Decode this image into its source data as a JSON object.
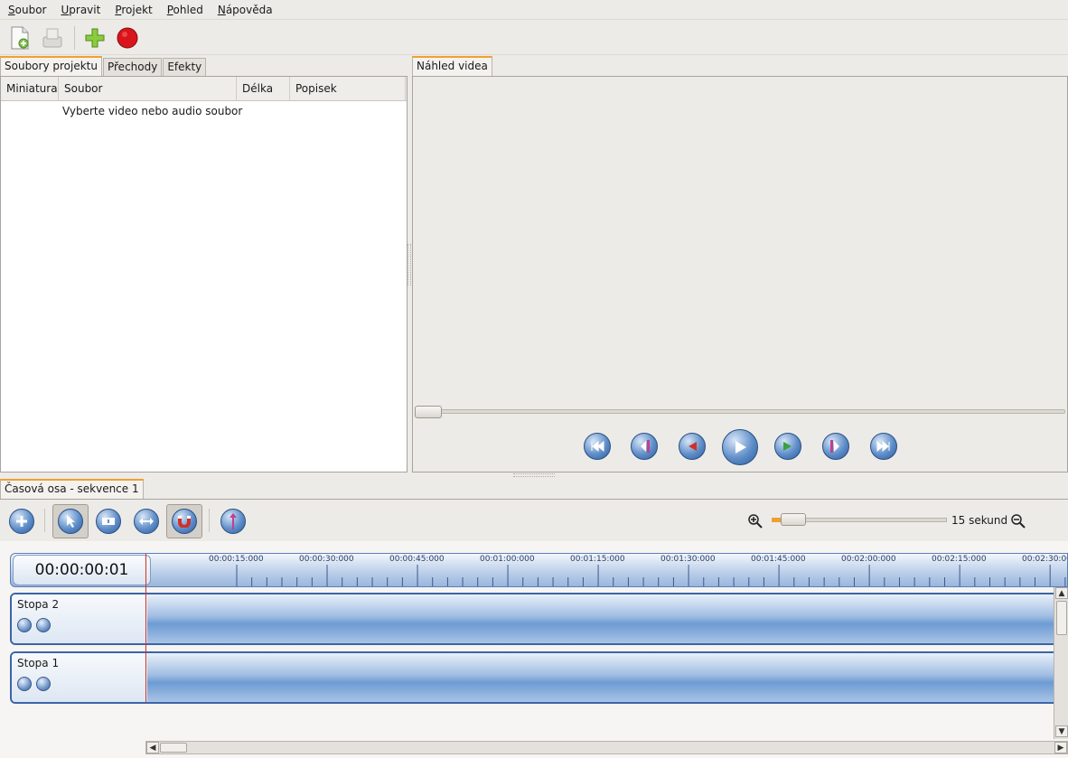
{
  "menu": [
    "Soubor",
    "Upravit",
    "Projekt",
    "Pohled",
    "Nápověda"
  ],
  "toolbar": {
    "icons": [
      "new-file-icon",
      "export-icon",
      "add-icon",
      "record-icon"
    ]
  },
  "left_panel": {
    "tabs": [
      "Soubory projektu",
      "Přechody",
      "Efekty"
    ],
    "columns": [
      "Miniatura",
      "Soubor",
      "Délka",
      "Popisek"
    ],
    "empty_message": "Vyberte video nebo audio soubor"
  },
  "preview": {
    "tab": "Náhled videa",
    "controls": [
      "skip-start-icon",
      "prev-marker-icon",
      "rewind-icon",
      "play-icon",
      "fast-forward-icon",
      "next-marker-icon",
      "skip-end-icon"
    ]
  },
  "timeline": {
    "tab": "Časová osa - sekvence 1",
    "zoom_label": "15 sekund",
    "timecode": "00:00:00:01",
    "ruler_labels": [
      "00:00:15:000",
      "00:00:30:000",
      "00:00:45:000",
      "00:01:00:000",
      "00:01:15:000",
      "00:01:30:000",
      "00:01:45:000",
      "00:02:00:000",
      "00:02:15:000",
      "00:02:30:00"
    ],
    "tracks": [
      {
        "name": "Stopa 2"
      },
      {
        "name": "Stopa 1"
      }
    ]
  },
  "colors": {
    "accent_tab": "#f0a030",
    "track_blue": "#6d9bd3",
    "playhead": "#d0302a"
  }
}
